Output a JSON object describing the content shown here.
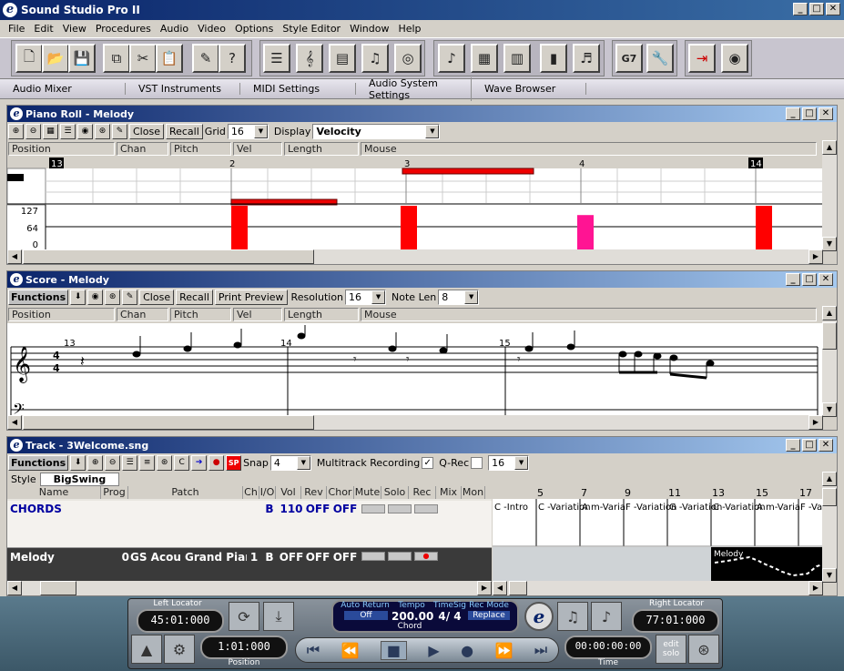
{
  "app": {
    "title": "Sound Studio Pro II",
    "logo": "e"
  },
  "menu": [
    "File",
    "Edit",
    "View",
    "Procedures",
    "Audio",
    "Video",
    "Options",
    "Style Editor",
    "Window",
    "Help"
  ],
  "toolbar_icons": [
    "new-icon",
    "open-icon",
    "save-icon",
    "copy-icon",
    "cut-icon",
    "paste-icon",
    "properties-icon",
    "help-icon",
    "list-editor-icon",
    "notation-icon",
    "lyrics-icon",
    "notes-icon",
    "drum-icon",
    "conductor-icon",
    "document-icon",
    "mixer-icon",
    "piano-icon",
    "chord-icon",
    "g7-icon",
    "tools-icon",
    "sync-icon",
    "cd-icon"
  ],
  "links": [
    "Audio Mixer",
    "VST Instruments",
    "MIDI Settings",
    "Audio System Settings",
    "Wave Browser"
  ],
  "piano_roll": {
    "title": "Piano Roll - Melody",
    "close": "Close",
    "recall": "Recall",
    "grid_label": "Grid",
    "grid_value": "16",
    "display_label": "Display",
    "display_value": "Velocity",
    "columns": [
      "Position",
      "Chan",
      "Pitch",
      "Vel",
      "Length",
      "Mouse"
    ],
    "ruler": [
      "13",
      "2",
      "3",
      "4",
      "14"
    ],
    "vel_labels": [
      "127",
      "64",
      "0"
    ],
    "vel_values": [
      127,
      127,
      100,
      127
    ]
  },
  "score": {
    "title": "Score - Melody",
    "functions": "Functions",
    "close": "Close",
    "recall": "Recall",
    "print": "Print Preview",
    "resolution_label": "Resolution",
    "resolution_value": "16",
    "notelen_label": "Note Len",
    "notelen_value": "8",
    "columns": [
      "Position",
      "Chan",
      "Pitch",
      "Vel",
      "Length",
      "Mouse"
    ],
    "measures": [
      "13",
      "14",
      "15"
    ],
    "time_sig": [
      "4",
      "4"
    ]
  },
  "track": {
    "title": "Track - 3Welcome.sng",
    "functions": "Functions",
    "snap_label": "Snap",
    "snap_value": "4",
    "multi_label": "Multitrack Recording",
    "qrec_label": "Q-Rec",
    "qrec_value": "16",
    "sp": "SP",
    "style_label": "Style",
    "style_value": "BigSwing",
    "headers": [
      "Name",
      "Prog",
      "Patch",
      "Ch",
      "I/O",
      "Vol",
      "Rev",
      "Chor",
      "Mute",
      "Solo",
      "Rec",
      "Mix",
      "Mon"
    ],
    "rows": [
      {
        "name": "CHORDS",
        "prog": "",
        "patch": "",
        "ch": "",
        "io": "B",
        "vol": "110",
        "rev": "OFF",
        "chor": "OFF"
      },
      {
        "name": "Melody",
        "prog": "0",
        "patch": "GS Acou Grand Piano",
        "ch": "1",
        "io": "B",
        "vol": "OFF",
        "rev": "OFF",
        "chor": "OFF"
      }
    ],
    "bars": [
      "5",
      "7",
      "9",
      "11",
      "13",
      "15",
      "17"
    ],
    "chord_cells": [
      "C -Intro",
      "C -Variation",
      "A  m-Varia",
      "F -Variation",
      "G -Variation",
      "C -Variation",
      "A  m-Varia",
      "F -Va"
    ],
    "clip_label": "Melody"
  },
  "transport": {
    "left_locator_label": "Left Locator",
    "left_locator": "45:01:000",
    "right_locator_label": "Right Locator",
    "right_locator": "77:01:000",
    "position": "1:01:000",
    "position_label": "Position",
    "time": "00:00:00:00",
    "time_label": "Time",
    "auto_return_label": "Auto Return",
    "auto_return": "Off",
    "tempo_label": "Tempo",
    "tempo": "200.00",
    "timesig_label": "TimeSig",
    "timesig": "4/ 4",
    "recmode_label": "Rec Mode",
    "recmode": "Replace",
    "chord": "Chord",
    "edit_solo": "edit solo"
  }
}
